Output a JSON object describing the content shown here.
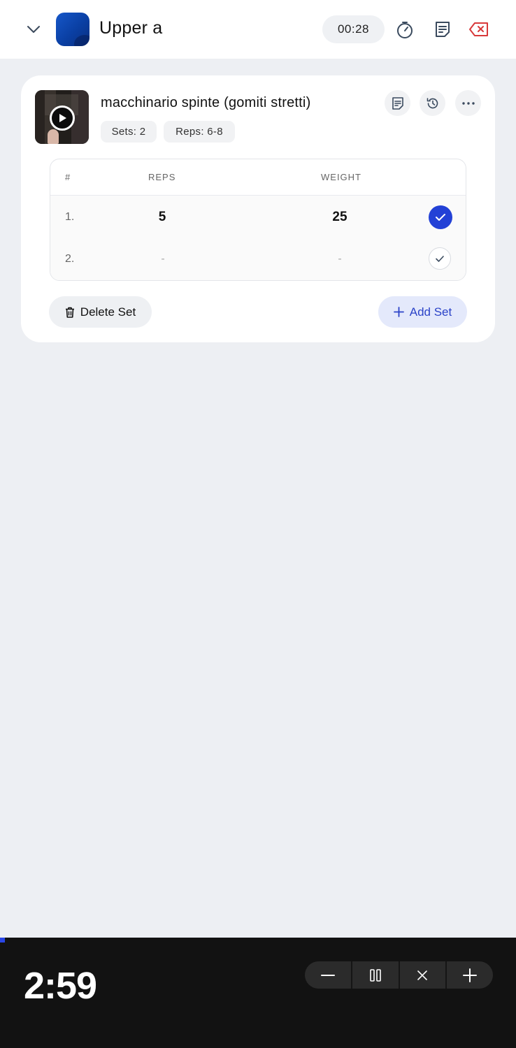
{
  "header": {
    "workout_title": "Upper a",
    "elapsed_time": "00:28",
    "icons": {
      "collapse": "chevron-down-icon",
      "workout": "workout-icon",
      "stopwatch": "stopwatch-icon",
      "notes": "notes-icon",
      "discard": "discard-icon"
    },
    "discard_color": "#d8393a"
  },
  "exercise": {
    "name": "macchinario spinte (gomiti stretti)",
    "tags": [
      "Sets: 2",
      "Reps: 6-8"
    ],
    "actions": [
      "notes-icon",
      "history-icon",
      "more-icon"
    ]
  },
  "sets_table": {
    "columns": [
      "#",
      "REPS",
      "WEIGHT"
    ],
    "rows": [
      {
        "number": "1.",
        "reps": "5",
        "weight": "25",
        "completed": true
      },
      {
        "number": "2.",
        "reps": "-",
        "weight": "-",
        "completed": false
      }
    ]
  },
  "buttons": {
    "delete_set": "Delete Set",
    "add_set": "Add Set"
  },
  "rest_timer": {
    "time": "2:59",
    "progress": 0.01,
    "controls": [
      "minus-icon",
      "pause-icon",
      "close-icon",
      "plus-icon"
    ],
    "accent": "#2a46e6"
  },
  "colors": {
    "accent": "#2341d6",
    "add_button_text": "#2b43c8",
    "background": "#edeff3"
  }
}
